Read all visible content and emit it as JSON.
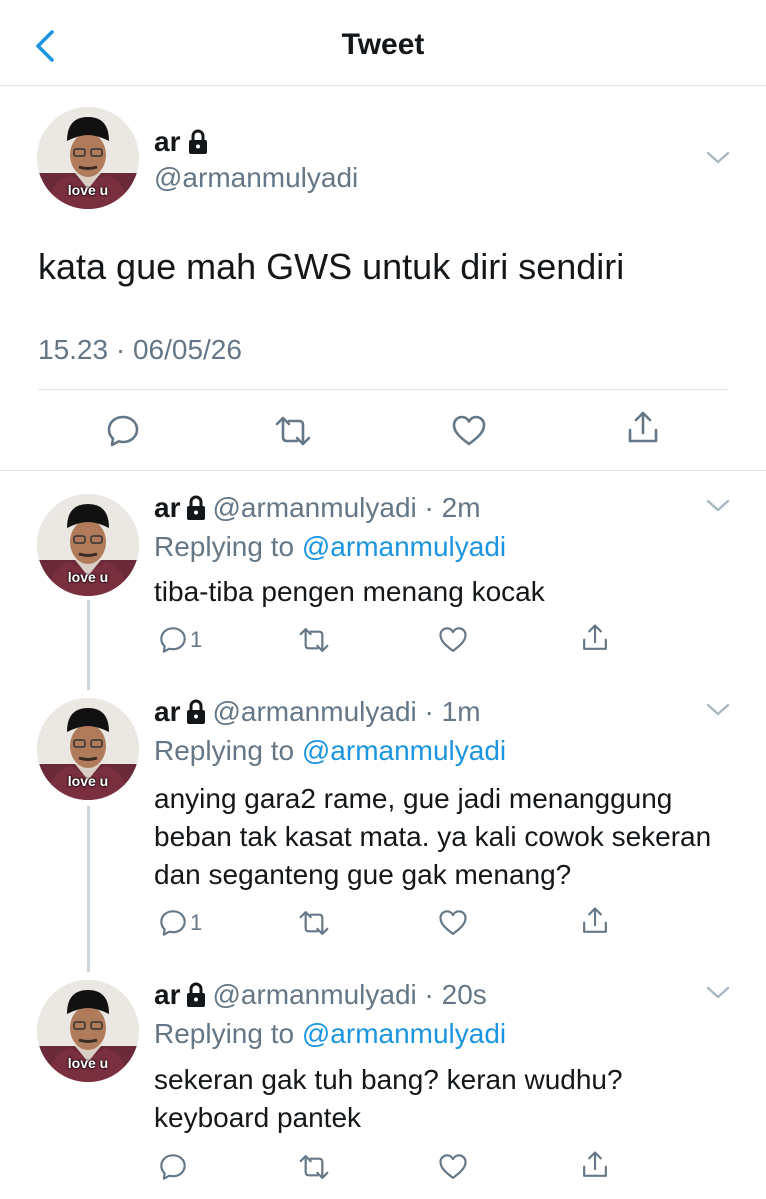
{
  "header": {
    "title": "Tweet"
  },
  "tweet": {
    "name": "ar",
    "handle": "@armanmulyadi",
    "avatar_caption": "love u",
    "text": "kata gue mah GWS untuk diri sendiri",
    "meta": "15.23 · 06/05/26"
  },
  "replies": [
    {
      "name": "ar",
      "handle_time": "@armanmulyadi · 2m",
      "replying_label": "Replying to",
      "mention": "@armanmulyadi",
      "text": "tiba-tiba pengen menang kocak",
      "reply_count": "1",
      "avatar_caption": "love u"
    },
    {
      "name": "ar",
      "handle_time": "@armanmulyadi · 1m",
      "replying_label": "Replying to",
      "mention": "@armanmulyadi",
      "text": "anying gara2 rame, gue jadi menanggung beban tak kasat mata. ya kali cowok sekeran dan seganteng gue gak menang?",
      "reply_count": "1",
      "avatar_caption": "love u"
    },
    {
      "name": "ar",
      "handle_time": "@armanmulyadi · 20s",
      "replying_label": "Replying to",
      "mention": "@armanmulyadi",
      "text": "sekeran gak tuh bang? keran wudhu? keyboard pantek",
      "reply_count": "",
      "avatar_caption": "love u"
    }
  ],
  "icons": {
    "back": "chevron-left-icon",
    "lock": "lock-icon",
    "menu": "chevron-down-icon",
    "reply": "reply-icon",
    "retweet": "retweet-icon",
    "like": "heart-icon",
    "share": "share-icon"
  },
  "colors": {
    "accent": "#1b95e0",
    "secondary_text": "#657786",
    "divider": "#e1e4e8"
  }
}
